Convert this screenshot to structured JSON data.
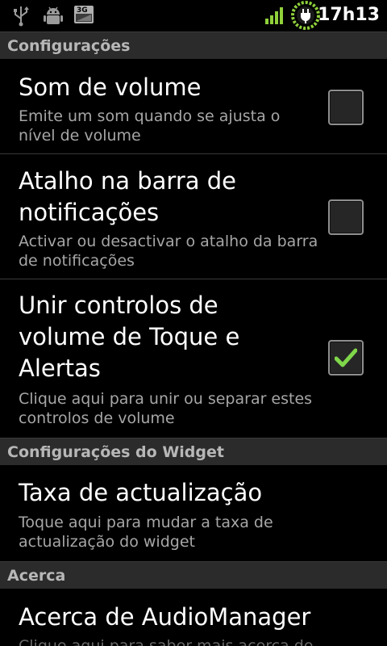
{
  "status_bar": {
    "time": "17h13",
    "icons": [
      "usb-icon",
      "android-debug-icon",
      "3g-icon",
      "signal-bars-icon",
      "battery-charging-icon"
    ],
    "network_label": "3G"
  },
  "sections": [
    {
      "header": "Configurações",
      "items": [
        {
          "title": "Som de volume",
          "summary": "Emite um som quando se ajusta o nível de volume",
          "checked": false
        },
        {
          "title": "Atalho na barra de notificações",
          "summary": "Activar ou desactivar o atalho da barra de notificações",
          "checked": false
        },
        {
          "title": "Unir controlos de volume de Toque e Alertas",
          "summary": "Clique aqui para unir ou separar estes controlos de volume",
          "checked": true
        }
      ]
    },
    {
      "header": "Configurações do Widget",
      "items": [
        {
          "title": "Taxa de actualização",
          "summary": "Toque aqui para mudar a taxa de actualização do widget"
        }
      ]
    },
    {
      "header": "Acerca",
      "items": [
        {
          "title": "Acerca de AudioManager",
          "summary": "Clique aqui para saber mais acerca de"
        }
      ]
    }
  ],
  "colors": {
    "check_green": "#7fd64a",
    "header_bg": "#2b2b2b",
    "summary_text": "#a6a6a6"
  }
}
